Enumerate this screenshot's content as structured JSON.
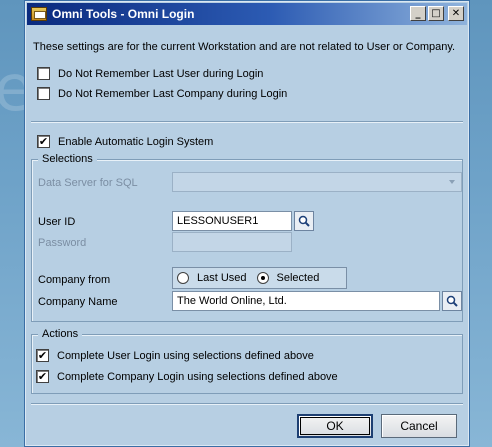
{
  "window": {
    "title": "Omni Tools - Omni Login",
    "controls": {
      "minimize": "_",
      "maximize": "□",
      "close": "✕"
    }
  },
  "background_text": "e",
  "info_text": "These settings are for the current Workstation and are not related to User or Company.",
  "options": [
    {
      "label": "Do Not Remember Last User during Login",
      "checked": false
    },
    {
      "label": "Do Not Remember Last Company during Login",
      "checked": false
    }
  ],
  "enable_auto_login": {
    "label": "Enable Automatic Login System",
    "checked": true
  },
  "selections": {
    "title": "Selections",
    "data_server_label": "Data Server for SQL",
    "data_server_value": "",
    "user_id_label": "User ID",
    "user_id_value": "LESSONUSER1",
    "password_label": "Password",
    "password_value": "",
    "company_from_label": "Company from",
    "company_from_options": [
      {
        "label": "Last Used",
        "selected": false
      },
      {
        "label": "Selected",
        "selected": true
      }
    ],
    "company_name_label": "Company Name",
    "company_name_value": "The World Online, Ltd."
  },
  "actions": {
    "title": "Actions",
    "items": [
      {
        "label": "Complete User Login using selections defined above",
        "checked": true
      },
      {
        "label": "Complete Company Login using selections defined above",
        "checked": true
      }
    ]
  },
  "buttons": {
    "ok": "OK",
    "cancel": "Cancel"
  },
  "colors": {
    "titlebar_start": "#0a2a7e",
    "window_bg": "#b7cfe3",
    "desktop": "#6ea2c8"
  }
}
